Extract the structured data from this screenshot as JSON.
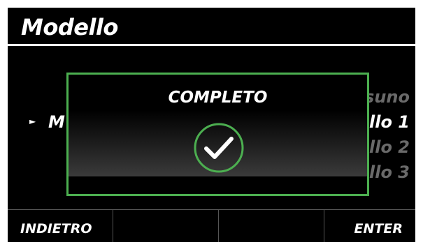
{
  "header": {
    "title": "Modello"
  },
  "menu": {
    "left_visible": "M",
    "items": [
      "suno",
      "llo 1",
      "llo 2",
      "llo 3"
    ]
  },
  "dialog": {
    "title": "COMPLETO",
    "status": "success"
  },
  "softkeys": {
    "left": "INDIETRO",
    "right": "ENTER"
  },
  "colors": {
    "accent": "#4caf50",
    "background": "#000000",
    "text": "#ffffff",
    "dim_text": "#6a6a6a"
  },
  "icons": {
    "check": "check-circle-icon",
    "selector": "triangle-right-icon"
  }
}
